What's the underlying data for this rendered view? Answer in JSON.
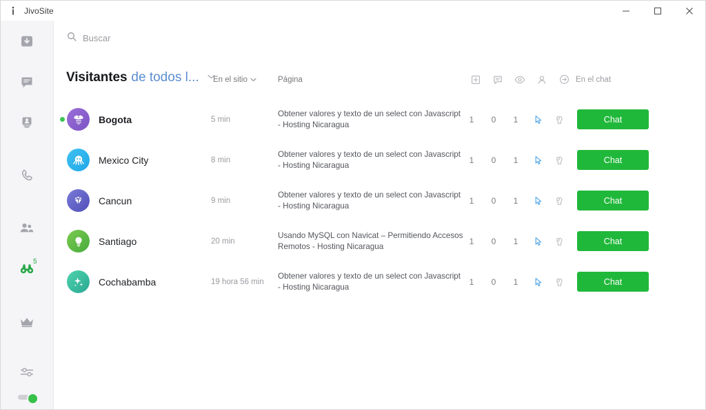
{
  "window": {
    "app_title": "JivoSite",
    "logo_icon": "jivo-logo-icon",
    "minimize_label": "Minimizar",
    "maximize_label": "Maximizar",
    "close_label": "Cerrar"
  },
  "sidebar": {
    "items": [
      {
        "name": "inbox-icon",
        "label": "Bandeja de entrada",
        "active": false,
        "badge": ""
      },
      {
        "name": "chats-icon",
        "label": "Chats",
        "active": false,
        "badge": ""
      },
      {
        "name": "contacts-icon",
        "label": "Contactos",
        "active": false,
        "badge": ""
      },
      {
        "name": "phone-icon",
        "label": "Llamadas",
        "active": false,
        "badge": ""
      },
      {
        "name": "teammates-icon",
        "label": "Equipo",
        "active": false,
        "badge": ""
      },
      {
        "name": "binoculars-icon",
        "label": "Visitantes",
        "active": true,
        "badge": "5"
      },
      {
        "name": "crown-icon",
        "label": "Premium",
        "active": false,
        "badge": ""
      },
      {
        "name": "sliders-icon",
        "label": "Ajustes",
        "active": false,
        "badge": ""
      }
    ],
    "status_toggle": {
      "name": "online-status-toggle",
      "state": "online"
    }
  },
  "search": {
    "icon": "search-icon",
    "placeholder": "Buscar",
    "value": ""
  },
  "toolbar": {
    "title_strong": "Visitantes",
    "title_accent": "de todos l...",
    "title_caret_icon": "chevron-down-icon",
    "site_filter": "En el sitio",
    "site_filter_caret_icon": "chevron-down-icon",
    "page_column": "Página",
    "chat_column": "En el chat",
    "metric_icons": [
      {
        "name": "page-enter-icon",
        "label": "Entradas"
      },
      {
        "name": "message-icon",
        "label": "Mensajes"
      },
      {
        "name": "eye-icon",
        "label": "Vistas"
      },
      {
        "name": "visitor-icon",
        "label": "Visitante"
      },
      {
        "name": "arrow-right-circle-icon",
        "label": "Fuente"
      }
    ]
  },
  "visitors": [
    {
      "online": true,
      "avatar_icon": "bee-avatar-icon",
      "avatar_color_from": "#9b6ed8",
      "avatar_color_to": "#7b53c4",
      "name": "Bogota",
      "bold": true,
      "time": "5 min",
      "page": "Obtener valores y texto de un select con Javascript - Hosting Nicaragua",
      "entries": "1",
      "messages": "0",
      "views": "1",
      "pointer_icon": "cursor-pointer-icon",
      "knock_icon": "knock-hand-icon",
      "chat_label": "Chat"
    },
    {
      "online": false,
      "avatar_icon": "octopus-avatar-icon",
      "avatar_color_from": "#3fc0f0",
      "avatar_color_to": "#1fa8e8",
      "name": "Mexico City",
      "bold": false,
      "time": "8 min",
      "page": "Obtener valores y texto de un select con Javascript - Hosting Nicaragua",
      "entries": "1",
      "messages": "0",
      "views": "1",
      "pointer_icon": "cursor-pointer-icon",
      "knock_icon": "knock-hand-icon",
      "chat_label": "Chat"
    },
    {
      "online": false,
      "avatar_icon": "diamond-avatar-icon",
      "avatar_color_from": "#6f6fd0",
      "avatar_color_to": "#4f4fb8",
      "name": "Cancun",
      "bold": false,
      "time": "9 min",
      "page": "Obtener valores y texto de un select con Javascript - Hosting Nicaragua",
      "entries": "1",
      "messages": "0",
      "views": "1",
      "pointer_icon": "cursor-pointer-icon",
      "knock_icon": "knock-hand-icon",
      "chat_label": "Chat"
    },
    {
      "online": false,
      "avatar_icon": "lightbulb-avatar-icon",
      "avatar_color_from": "#74c84a",
      "avatar_color_to": "#46ab3e",
      "name": "Santiago",
      "bold": false,
      "time": "20 min",
      "page": "Usando MySQL con Navicat – Permitiendo Accesos Remotos - Hosting Nicaragua",
      "entries": "1",
      "messages": "0",
      "views": "1",
      "pointer_icon": "cursor-pointer-icon",
      "knock_icon": "knock-hand-icon",
      "chat_label": "Chat"
    },
    {
      "online": false,
      "avatar_icon": "sparkles-avatar-icon",
      "avatar_color_from": "#43c9a8",
      "avatar_color_to": "#29a892",
      "name": "Cochabamba",
      "bold": false,
      "time": "19 hora 56 min",
      "page": "Obtener valores y texto de un select con Javascript - Hosting Nicaragua",
      "entries": "1",
      "messages": "0",
      "views": "1",
      "pointer_icon": "cursor-pointer-icon",
      "knock_icon": "knock-hand-icon",
      "chat_label": "Chat"
    }
  ],
  "colors": {
    "accent_green": "#20b83a",
    "link_blue": "#5b8dd0",
    "sidebar_bg": "#f5f5f7",
    "online_dot": "#3ec454"
  }
}
